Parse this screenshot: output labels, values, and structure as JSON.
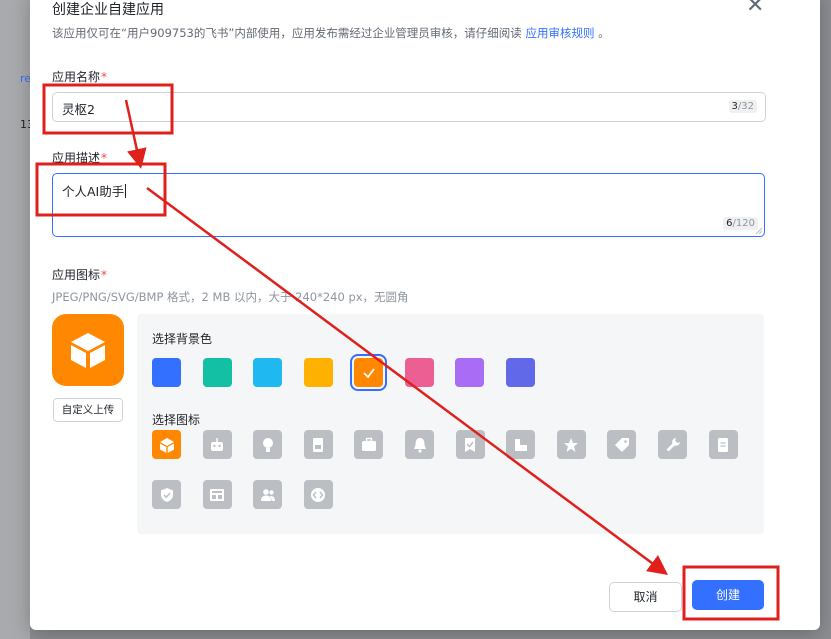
{
  "background": {
    "fragment_1": "re",
    "fragment_2": "13"
  },
  "dialog": {
    "title": "创建企业自建应用",
    "close_icon": "close-icon",
    "description_prefix": "该应用仅可在“用户909753的飞书”内部使用，应用发布需经过企业管理员审核，请仔细阅读",
    "description_link": "应用审核规则",
    "description_suffix": "。"
  },
  "form": {
    "name_label": "应用名称",
    "name_value": "灵枢2",
    "name_count": "3",
    "name_max": "/32",
    "desc_label": "应用描述",
    "desc_value": "个人AI助手",
    "desc_count": "6",
    "desc_max": "/120",
    "required_mark": "*",
    "icon_label": "应用图标",
    "icon_hint": "JPEG/PNG/SVG/BMP 格式，2 MB 以内，大于 240*240 px，无圆角",
    "upload_label": "自定义上传"
  },
  "picker": {
    "bg_label": "选择背景色",
    "icon_label": "选择图标",
    "colors": [
      "#3370ff",
      "#14c0a4",
      "#1fb8f0",
      "#ffb100",
      "#ff8800",
      "#ec5f93",
      "#a86cf5",
      "#6169e8"
    ],
    "selected_color": "#ff8800",
    "icons": [
      "box-icon",
      "robot-icon",
      "lightbulb-icon",
      "document-icon",
      "briefcase-icon",
      "bell-icon",
      "bookmark-check-icon",
      "chart-icon",
      "star-icon",
      "tag-icon",
      "wrench-icon",
      "file-icon",
      "shield-icon",
      "layout-icon",
      "users-icon",
      "code-icon"
    ],
    "selected_icon": "box-icon"
  },
  "footer": {
    "cancel_label": "取消",
    "create_label": "创建"
  },
  "annotations": {
    "color": "#e0201c"
  }
}
